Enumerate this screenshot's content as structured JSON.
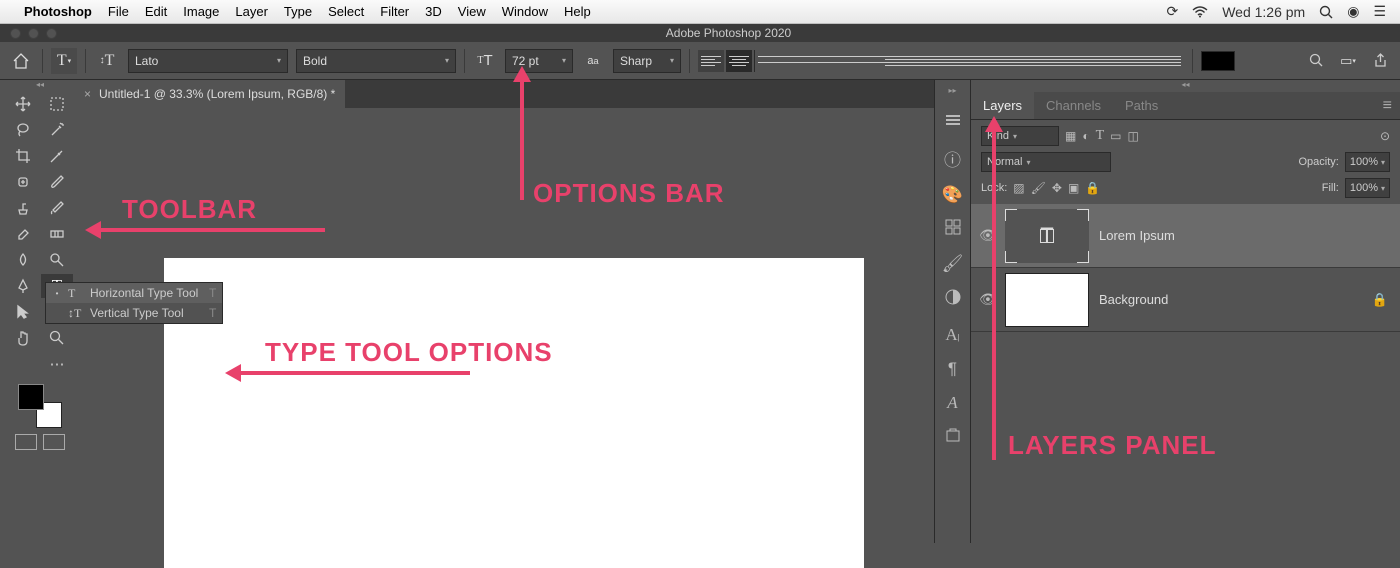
{
  "accent": "#e8416b",
  "menubar": {
    "apple": "",
    "items": [
      "Photoshop",
      "File",
      "Edit",
      "Image",
      "Layer",
      "Type",
      "Select",
      "Filter",
      "3D",
      "View",
      "Window",
      "Help"
    ],
    "time": "Wed 1:26 pm"
  },
  "window": {
    "title": "Adobe Photoshop 2020"
  },
  "options": {
    "font": "Lato",
    "weight": "Bold",
    "size": "72 pt",
    "aa": "Sharp"
  },
  "document": {
    "tab": "Untitled-1 @ 33.3% (Lorem Ipsum, RGB/8) *"
  },
  "flyout": {
    "items": [
      {
        "icon": "T",
        "label": "Horizontal Type Tool",
        "key": "T"
      },
      {
        "icon": "↕T",
        "label": "Vertical Type Tool",
        "key": "T"
      }
    ]
  },
  "panels": {
    "tabs": [
      "Layers",
      "Channels",
      "Paths"
    ],
    "kind": "Kind",
    "blend": "Normal",
    "opacity_lbl": "Opacity:",
    "opacity_val": "100%",
    "lock_lbl": "Lock:",
    "fill_lbl": "Fill:",
    "fill_val": "100%",
    "layers": [
      {
        "name": "Lorem Ipsum",
        "type": "text"
      },
      {
        "name": "Background",
        "type": "raster",
        "locked": true
      }
    ]
  },
  "annotations": {
    "toolbar": "TOOLBAR",
    "options_bar": "OPTIONS BAR",
    "type_tool": "TYPE TOOL OPTIONS",
    "layers": "LAYERS PANEL"
  }
}
